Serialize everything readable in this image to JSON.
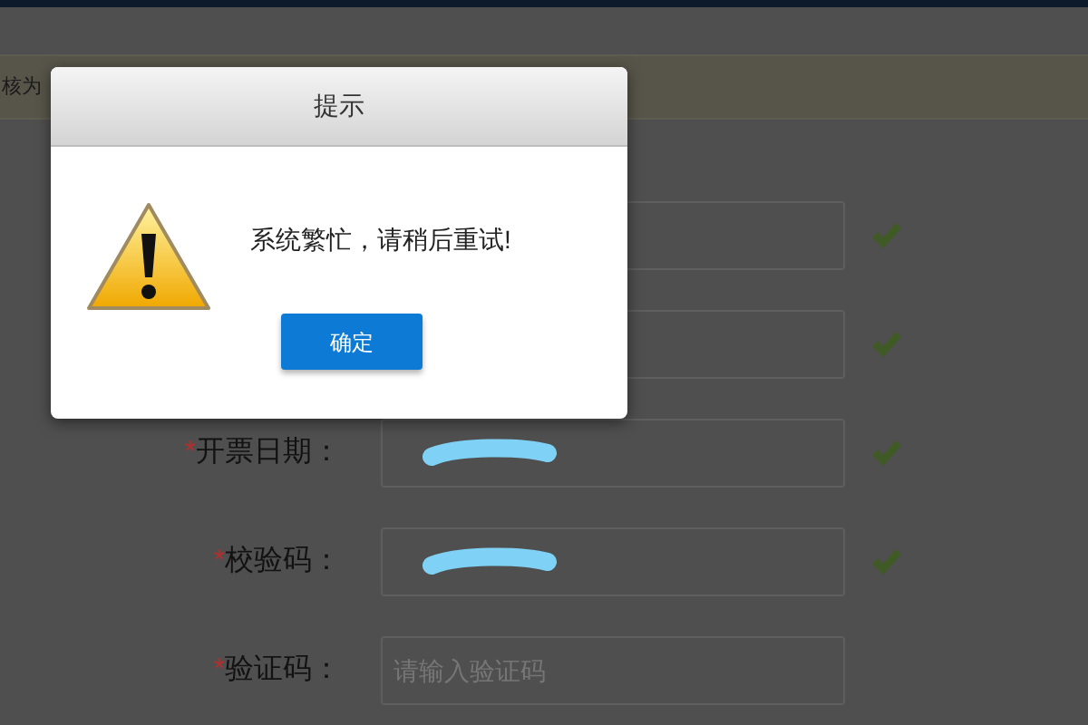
{
  "notice": {
    "text": "核为"
  },
  "form": {
    "fields": [
      {
        "redacted": false,
        "valid": true
      },
      {
        "redacted": false,
        "valid": true
      },
      {
        "required_mark": "*",
        "label": "开票日期：",
        "redacted": true,
        "valid": true
      },
      {
        "required_mark": "*",
        "label": "校验码：",
        "redacted": true,
        "valid": true
      },
      {
        "required_mark": "*",
        "label": "验证码：",
        "redacted": false,
        "placeholder": "请输入验证码",
        "valid": false
      }
    ]
  },
  "dialog": {
    "title": "提示",
    "message": "系统繁忙，请稍后重试!",
    "button": "确定"
  }
}
